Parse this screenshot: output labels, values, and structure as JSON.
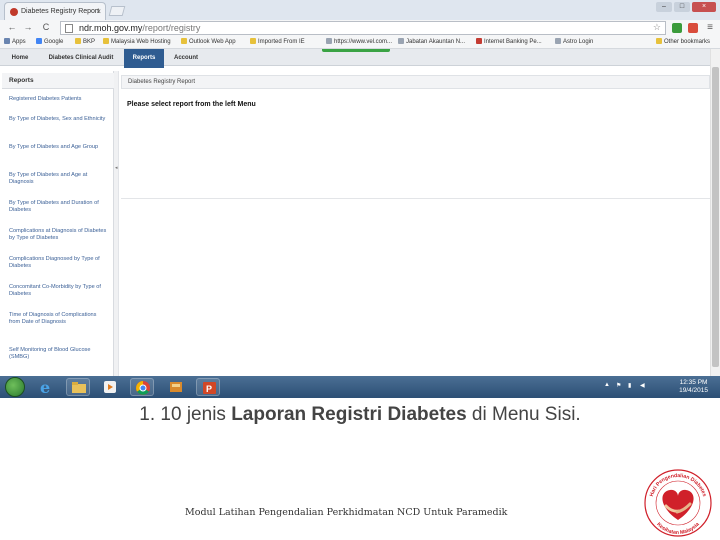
{
  "browser": {
    "tab_title": "Diabetes Registry Report",
    "tab_close": "×",
    "back": "←",
    "forward": "→",
    "reload": "C",
    "url_domain": "ndr.moh.gov.my",
    "url_path": "/report/registry",
    "bookmarks": [
      "Apps",
      "Google",
      "BKP",
      "Malaysia Web Hosting",
      "Outlook Web App",
      "Imported From IE",
      "https://www.vel.com...",
      "Jabatan Akauntan N...",
      "Internet Banking Pe...",
      "Astro Login"
    ],
    "other_bookmarks": "Other bookmarks"
  },
  "app": {
    "nav": [
      "Home",
      "Diabetes Clinical Audit",
      "Reports",
      "Account"
    ],
    "active_nav": "Reports",
    "sidebar_title": "Reports",
    "sidebar_items": [
      "Registered Diabetes Patients",
      "By Type of Diabetes, Sex and Ethnicity",
      "By Type of Diabetes and Age Group",
      "By Type of Diabetes and Age at Diagnosis",
      "By Type of Diabetes and Duration of Diabetes",
      "Complications at Diagnosis of Diabetes by Type of Diabetes",
      "Complications Diagnosed by Type of Diabetes",
      "Concomitant Co-Morbidity by Type of Diabetes",
      "Time of Diagnosis of Complications from Date of Diagnosis",
      "Self Monitoring of Blood Glucose (SMBG)"
    ],
    "content_header": "Diabetes Registry Report",
    "content_message": "Please select report from the left Menu"
  },
  "taskbar": {
    "clock_time": "12:35 PM",
    "clock_date": "19/4/2015"
  },
  "slide": {
    "caption_prefix": "1. 10 jenis ",
    "caption_bold": "Laporan Registri Diabetes",
    "caption_suffix": " di Menu Sisi.",
    "footer": "Modul Latihan Pengendalian Perkhidmatan NCD Untuk Paramedik",
    "logo_text_top": "Hari Pengendalian Diabetes",
    "logo_text_bottom": "Kesihatan Malaysia"
  },
  "colors": {
    "accent": "#2f5c91",
    "link": "#3a5f96",
    "logo_red": "#d0202a"
  }
}
